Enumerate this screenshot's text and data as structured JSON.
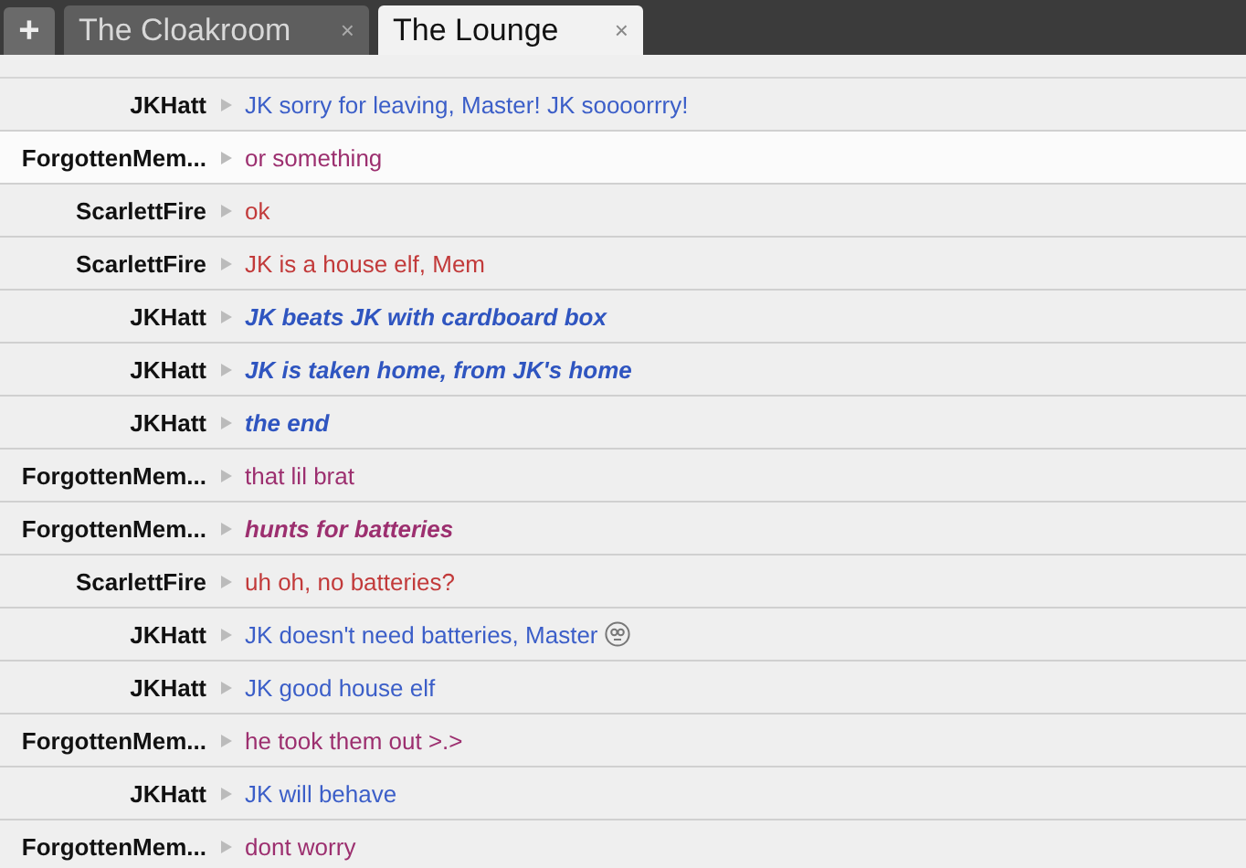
{
  "tabbar": {
    "new_tab": "+",
    "tabs": [
      {
        "label": "The Cloakroom",
        "close": "×",
        "selected": false
      },
      {
        "label": "The Lounge",
        "close": "×",
        "selected": true
      }
    ]
  },
  "messages": [
    {
      "author": "JKHatt",
      "text": "JK sorry for leaving, Master! JK soooorrry!",
      "kind": "say",
      "color": "#3b5ec8",
      "selected": false
    },
    {
      "author": "ForgottenMem...",
      "text": "or something",
      "kind": "say",
      "color": "#9c2f6f",
      "selected": true
    },
    {
      "author": "ScarlettFire",
      "text": "ok",
      "kind": "say",
      "color": "#c23a3a",
      "selected": false
    },
    {
      "author": "ScarlettFire",
      "text": "JK is a house elf, Mem",
      "kind": "say",
      "color": "#c23a3a",
      "selected": false
    },
    {
      "author": "JKHatt",
      "text": "JK beats JK with cardboard box",
      "kind": "action",
      "color": "#2f55c0",
      "selected": false
    },
    {
      "author": "JKHatt",
      "text": "JK is taken home, from JK's home",
      "kind": "action",
      "color": "#2f55c0",
      "selected": false
    },
    {
      "author": "JKHatt",
      "text": "the end",
      "kind": "action",
      "color": "#2f55c0",
      "selected": false
    },
    {
      "author": "ForgottenMem...",
      "text": "that lil brat",
      "kind": "say",
      "color": "#9c2f6f",
      "selected": false
    },
    {
      "author": "ForgottenMem...",
      "text": "hunts for batteries",
      "kind": "action",
      "color": "#9c2f6f",
      "selected": false
    },
    {
      "author": "ScarlettFire",
      "text": "uh oh, no batteries?",
      "kind": "say",
      "color": "#c23a3a",
      "selected": false
    },
    {
      "author": "JKHatt",
      "text": "JK doesn't need batteries, Master",
      "kind": "say",
      "color": "#3b5ec8",
      "selected": false,
      "emoticon": true
    },
    {
      "author": "JKHatt",
      "text": "JK good house elf",
      "kind": "say",
      "color": "#3b5ec8",
      "selected": false
    },
    {
      "author": "ForgottenMem...",
      "text": "he took them out >.>",
      "kind": "say",
      "color": "#9c2f6f",
      "selected": false
    },
    {
      "author": "JKHatt",
      "text": "JK will behave",
      "kind": "say",
      "color": "#3b5ec8",
      "selected": false
    },
    {
      "author": "ForgottenMem...",
      "text": "dont worry",
      "kind": "say",
      "color": "#9c2f6f",
      "selected": false
    }
  ]
}
